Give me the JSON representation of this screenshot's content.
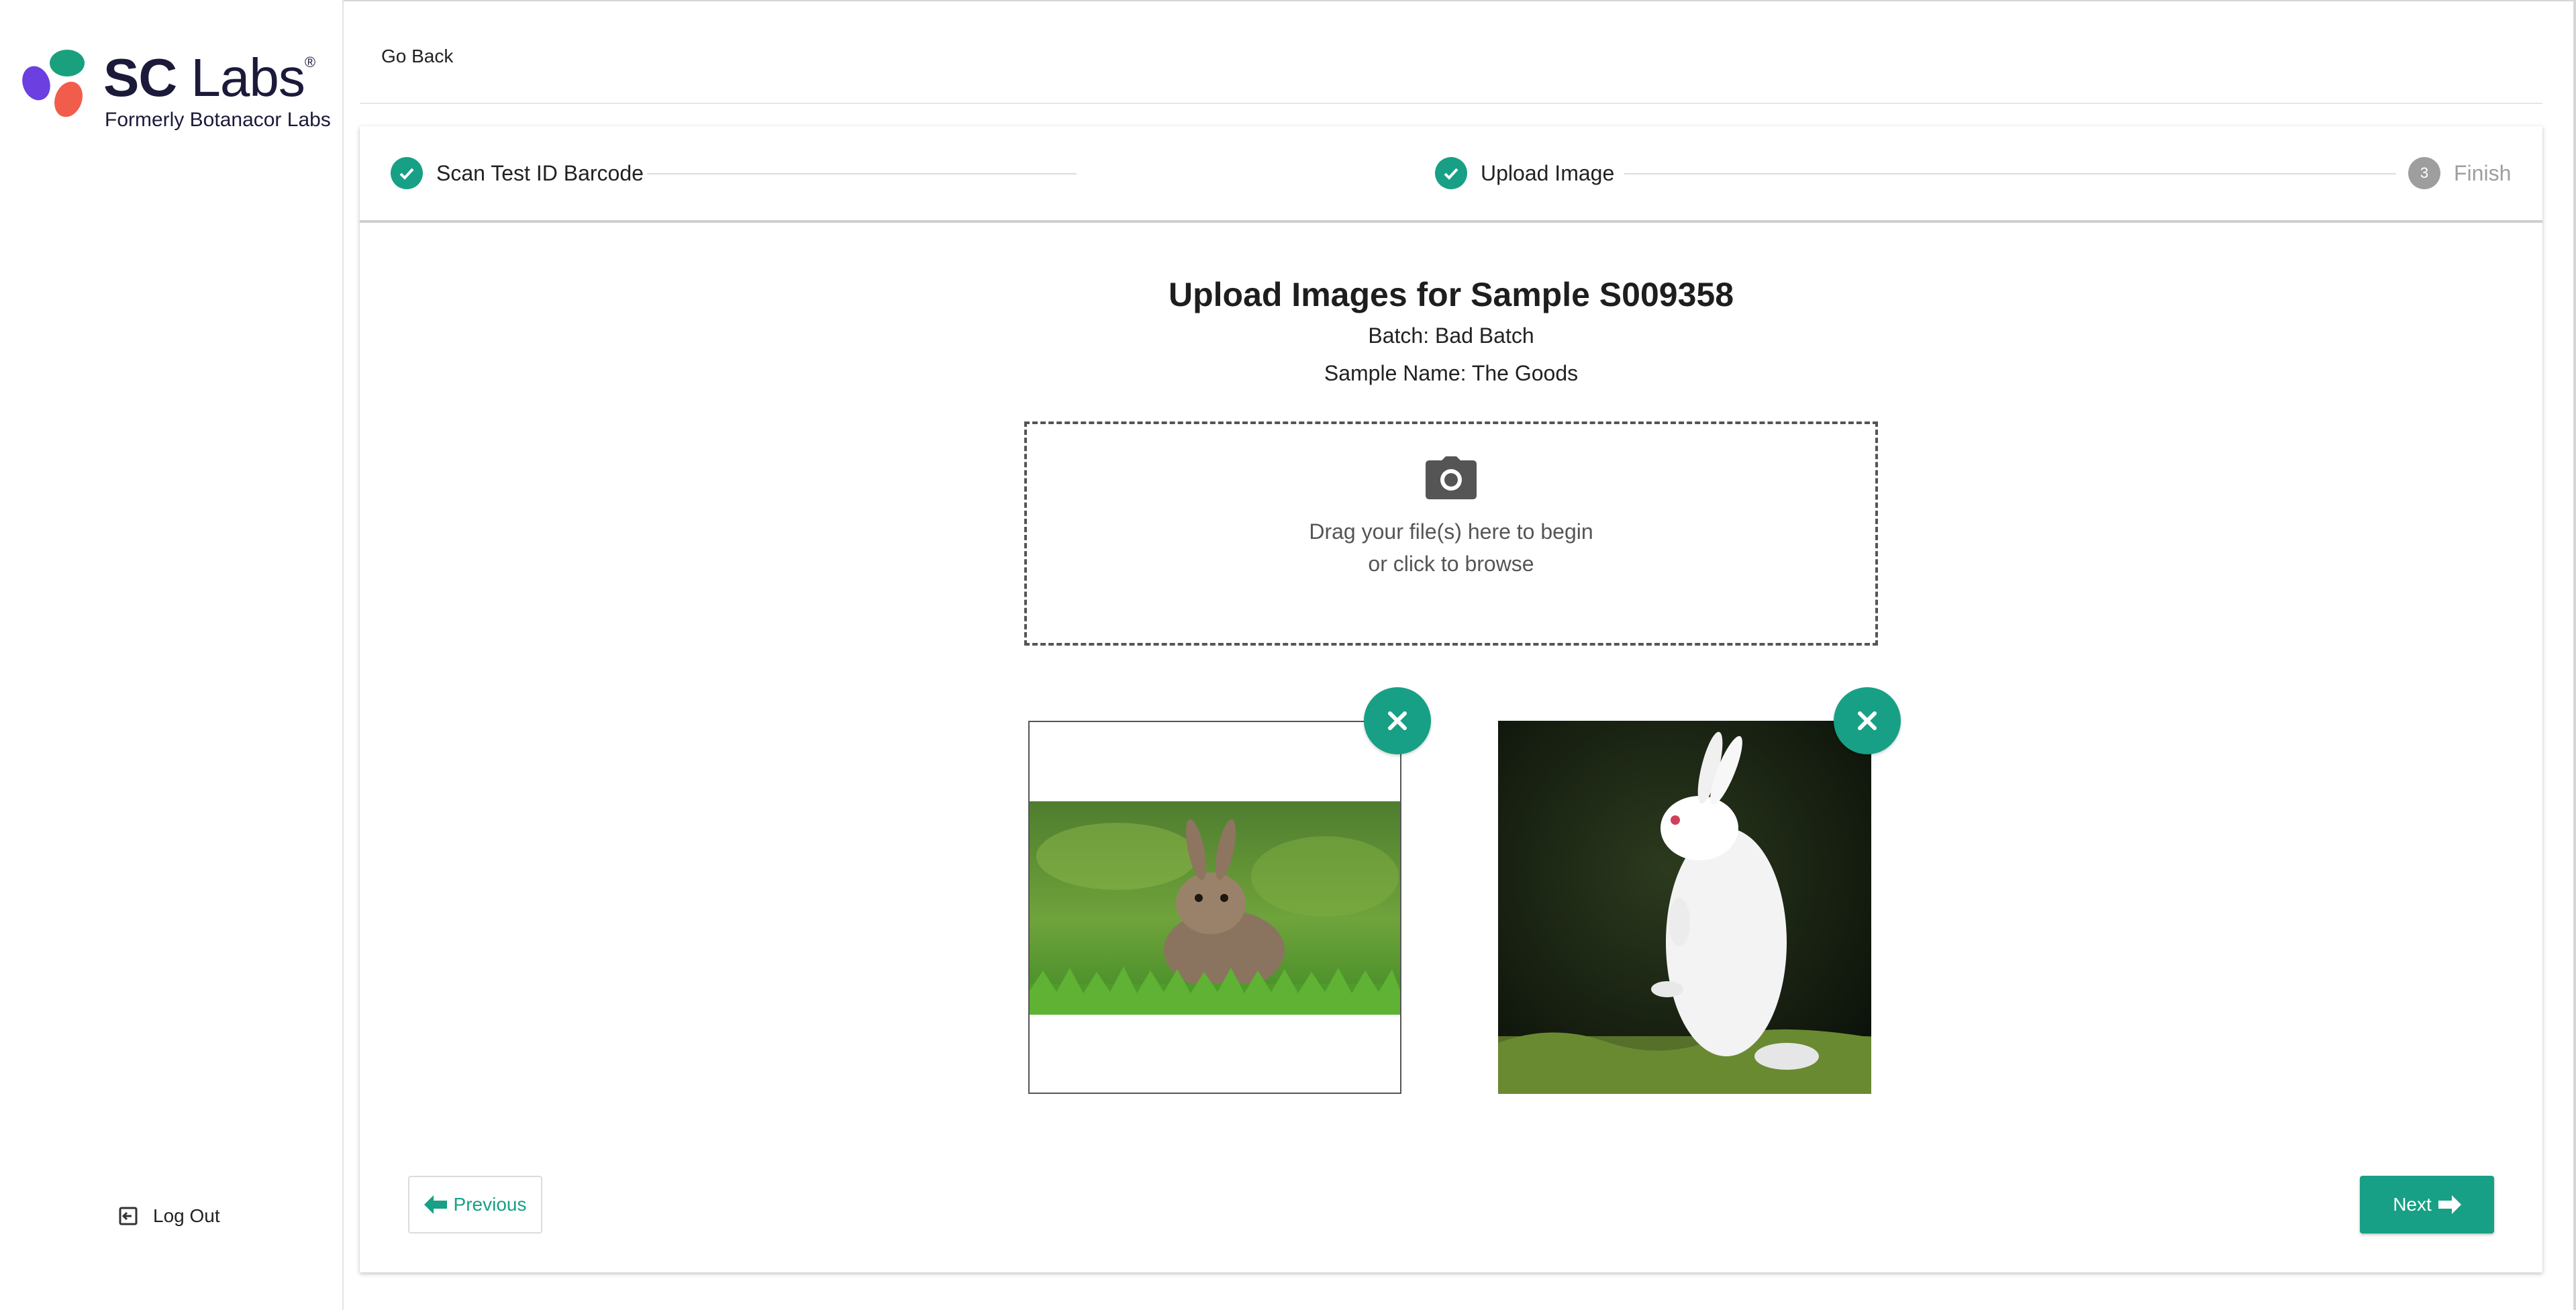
{
  "brand": {
    "name_bold": "SC",
    "name_light": " Labs",
    "registered": "®",
    "tagline": "Formerly Botanacor Labs",
    "colors": [
      "#6b3fe0",
      "#1aa07d",
      "#f25c4a"
    ]
  },
  "sidebar": {
    "logout_label": "Log Out",
    "logout_icon": "logout-icon"
  },
  "header": {
    "go_back_label": "Go Back"
  },
  "stepper": {
    "steps": [
      {
        "label": "Scan Test ID Barcode",
        "state": "completed"
      },
      {
        "label": "Upload Image",
        "state": "completed"
      },
      {
        "label": "Finish",
        "state": "pending",
        "number": "3"
      }
    ]
  },
  "main": {
    "title": "Upload Images for Sample S009358",
    "batch": "Batch: Bad Batch",
    "sample_name": "Sample Name: The Goods",
    "dropzone": {
      "icon": "camera-icon",
      "line1": "Drag your file(s) here to begin",
      "line2": "or click to browse"
    },
    "images": [
      {
        "subject": "brown rabbit in grass",
        "remove_icon": "close-icon"
      },
      {
        "subject": "white rabbit standing",
        "remove_icon": "close-icon"
      }
    ]
  },
  "footer": {
    "previous_label": "Previous",
    "next_label": "Next"
  },
  "accent": "#17a085"
}
